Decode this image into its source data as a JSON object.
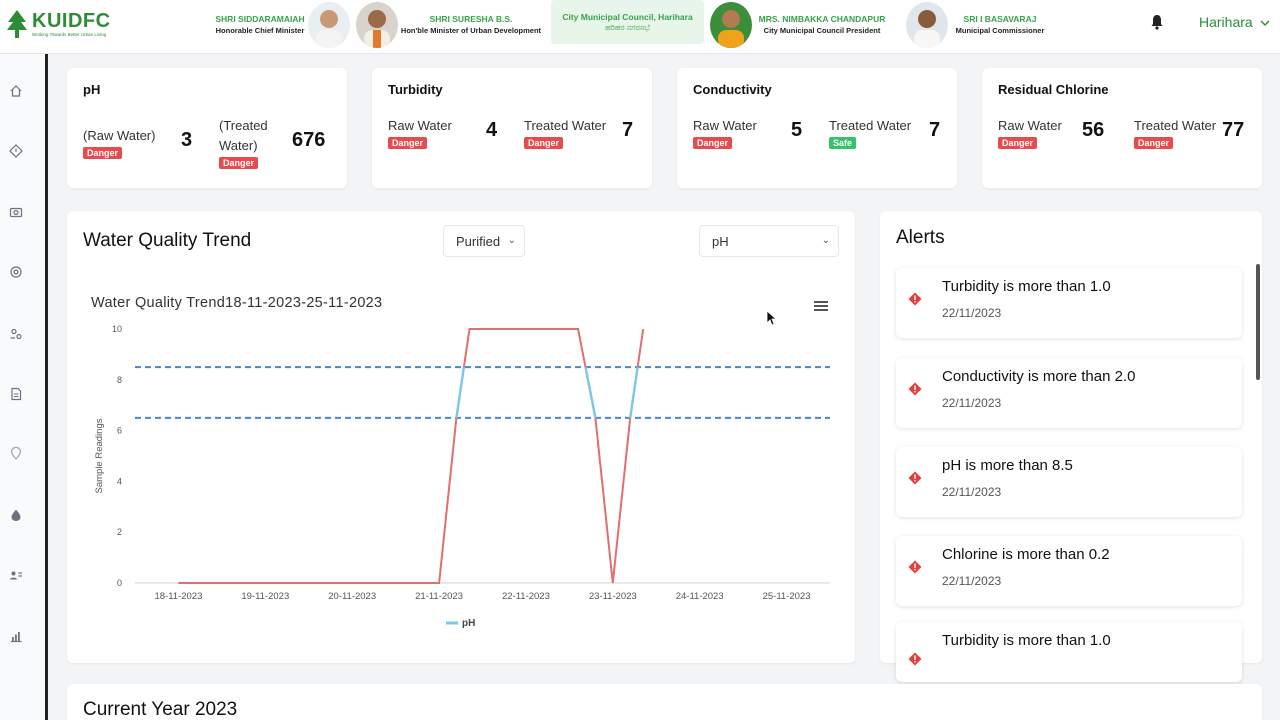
{
  "header": {
    "logo_title": "KUIDFC",
    "logo_tagline": "Working Towards Better Urban Living",
    "dignitaries": [
      {
        "name": "SHRI SIDDARAMAIAH",
        "role": "Honorable Chief Minister"
      },
      {
        "name": "SHRI SURESHA B.S.",
        "role": "Hon'ble Minister of Urban Development"
      },
      {
        "name": "MRS. NIMBAKKA CHANDAPUR",
        "role": "City Municipal Council President"
      },
      {
        "name": "SRI I BASAVARAJ",
        "role": "Municipal Commissioner"
      }
    ],
    "council": {
      "name": "City Municipal Council, Harihara",
      "name_kn": "ಹರಿಹರ ನಗರಸಭೆ"
    },
    "city": "Harihara",
    "icons": {
      "bell": "bell-icon",
      "city_caret": "chevron-down-icon"
    }
  },
  "sidebar": {
    "items": [
      "home-icon",
      "alert-diamond-icon",
      "camera-icon",
      "settings-icon",
      "users-icon",
      "document-icon",
      "map-pin-icon",
      "water-drop-icon",
      "user-card-icon",
      "bar-chart-icon"
    ]
  },
  "metrics": [
    {
      "title": "pH",
      "raw_label": "(Raw Water)",
      "raw_value": "3",
      "raw_status": "Danger",
      "treated_label": "(Treated Water)",
      "treated_value": "676",
      "treated_status": "Danger"
    },
    {
      "title": "Turbidity",
      "raw_label": "Raw Water",
      "raw_value": "4",
      "raw_status": "Danger",
      "treated_label": "Treated Water",
      "treated_value": "7",
      "treated_status": "Danger"
    },
    {
      "title": "Conductivity",
      "raw_label": "Raw Water",
      "raw_value": "5",
      "raw_status": "Danger",
      "treated_label": "Treated Water",
      "treated_value": "7",
      "treated_status": "Safe"
    },
    {
      "title": "Residual Chlorine",
      "raw_label": "Raw Water",
      "raw_value": "56",
      "raw_status": "Danger",
      "treated_label": "Treated Water",
      "treated_value": "77",
      "treated_status": "Danger"
    }
  ],
  "trend": {
    "title": "Water Quality Trend",
    "filter_type": "Purified",
    "filter_param": "pH",
    "chart_menu_icon": "hamburger-menu-icon"
  },
  "chart_data": {
    "type": "line",
    "title": "Water Quality Trend18-11-2023-25-11-2023",
    "xlabel": "",
    "ylabel": "Sample Readings",
    "ylim": [
      0,
      10
    ],
    "yticks": [
      0,
      2,
      4,
      6,
      8,
      10
    ],
    "categories": [
      "18-11-2023",
      "19-11-2023",
      "20-11-2023",
      "21-11-2023",
      "22-11-2023",
      "23-11-2023",
      "24-11-2023",
      "25-11-2023"
    ],
    "series": [
      {
        "name": "pH",
        "x": [
          0,
          1,
          2,
          3,
          3.2,
          3.35,
          4.6,
          4.8,
          5.0,
          5.2,
          5.35
        ],
        "y": [
          0,
          0,
          0,
          0,
          6.5,
          10,
          10,
          6.5,
          0,
          6.5,
          10
        ]
      }
    ],
    "thresholds": [
      8.5,
      6.5
    ],
    "legend_position": "bottom-center",
    "grid": false,
    "colors": {
      "line": "#e06f6f",
      "in_range": "#7cc8e8",
      "threshold": "#4a86c8"
    }
  },
  "alerts": {
    "title": "Alerts",
    "items": [
      {
        "text": "Turbidity is more than 1.0",
        "date": "22/11/2023"
      },
      {
        "text": "Conductivity is more than 2.0",
        "date": "22/11/2023"
      },
      {
        "text": "pH is more than 8.5",
        "date": "22/11/2023"
      },
      {
        "text": "Chlorine is more than 0.2",
        "date": "22/11/2023"
      },
      {
        "text": "Turbidity is more than 1.0",
        "date": ""
      }
    ]
  },
  "current_year": {
    "title": "Current Year 2023"
  },
  "colors": {
    "brand": "#2e8b3a",
    "danger": "#e74c4c",
    "safe": "#34c36a",
    "alert_icon": "#e53e3e"
  }
}
